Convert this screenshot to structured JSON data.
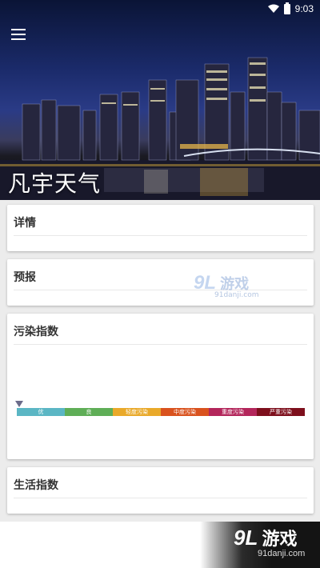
{
  "status_bar": {
    "time": "9:03"
  },
  "header": {
    "app_title": "凡宇天气"
  },
  "cards": {
    "details": {
      "title": "详情"
    },
    "forecast": {
      "title": "预报"
    },
    "pollution": {
      "title": "污染指数",
      "scale": [
        {
          "label": "优",
          "color": "#5bb6c4"
        },
        {
          "label": "良",
          "color": "#5fae57"
        },
        {
          "label": "轻度污染",
          "color": "#e9a92a"
        },
        {
          "label": "中度污染",
          "color": "#d9521e"
        },
        {
          "label": "重度污染",
          "color": "#b3265b"
        },
        {
          "label": "严重污染",
          "color": "#7d0f1c"
        }
      ]
    },
    "life": {
      "title": "生活指数"
    }
  },
  "watermark": {
    "mid_big": "9L",
    "mid_cn": "游戏",
    "mid_url": "91danji.com",
    "bottom_big": "9L",
    "bottom_cn": "游戏",
    "bottom_url": "91danji.com"
  }
}
